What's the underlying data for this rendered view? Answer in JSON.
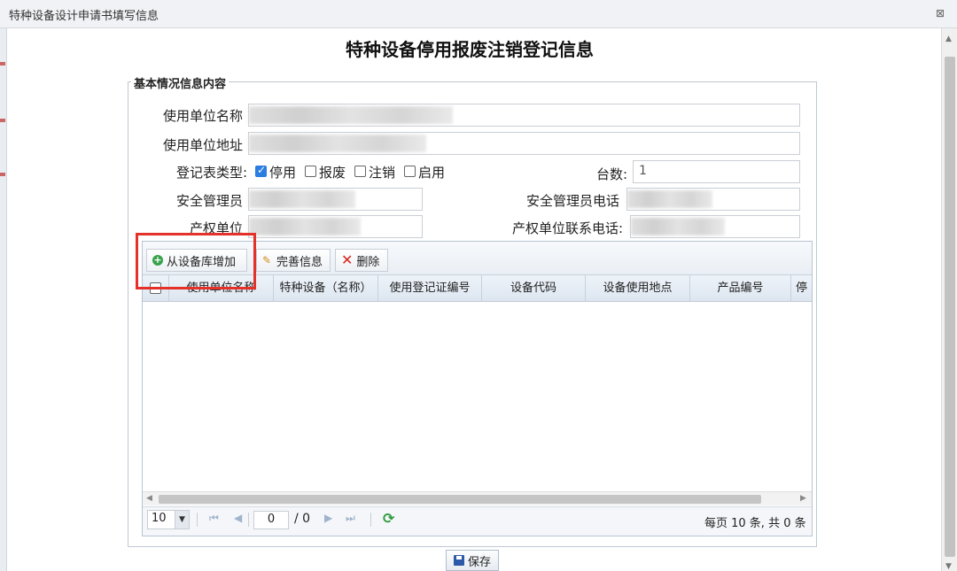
{
  "window": {
    "title": "特种设备设计申请书填写信息",
    "close_glyph": "⊠"
  },
  "page_title": "特种设备停用报废注销登记信息",
  "section_legend": "基本情况信息内容",
  "form": {
    "unit_name_label": "使用单位名称",
    "unit_address_label": "使用单位地址",
    "reg_type_label": "登记表类型:",
    "reg_types": [
      {
        "label": "停用",
        "checked": true
      },
      {
        "label": "报废",
        "checked": false
      },
      {
        "label": "注销",
        "checked": false
      },
      {
        "label": "启用",
        "checked": false
      }
    ],
    "count_label": "台数:",
    "count_value": "1",
    "safety_manager_label": "安全管理员",
    "safety_manager_phone_label": "安全管理员电话",
    "property_unit_label": "产权单位",
    "property_unit_phone_label": "产权单位联系电话:"
  },
  "toolbar": {
    "add_from_library": "从设备库增加",
    "complete_info": "完善信息",
    "delete": "删除"
  },
  "table": {
    "columns": [
      "使用单位名称",
      "特种设备（名称）",
      "使用登记证编号",
      "设备代码",
      "设备使用地点",
      "产品编号",
      "停"
    ]
  },
  "pager": {
    "page_size": "10",
    "current_page": "0",
    "total_pages": "/ 0",
    "summary": "每页 10 条, 共 0 条"
  },
  "save_button": "保存"
}
